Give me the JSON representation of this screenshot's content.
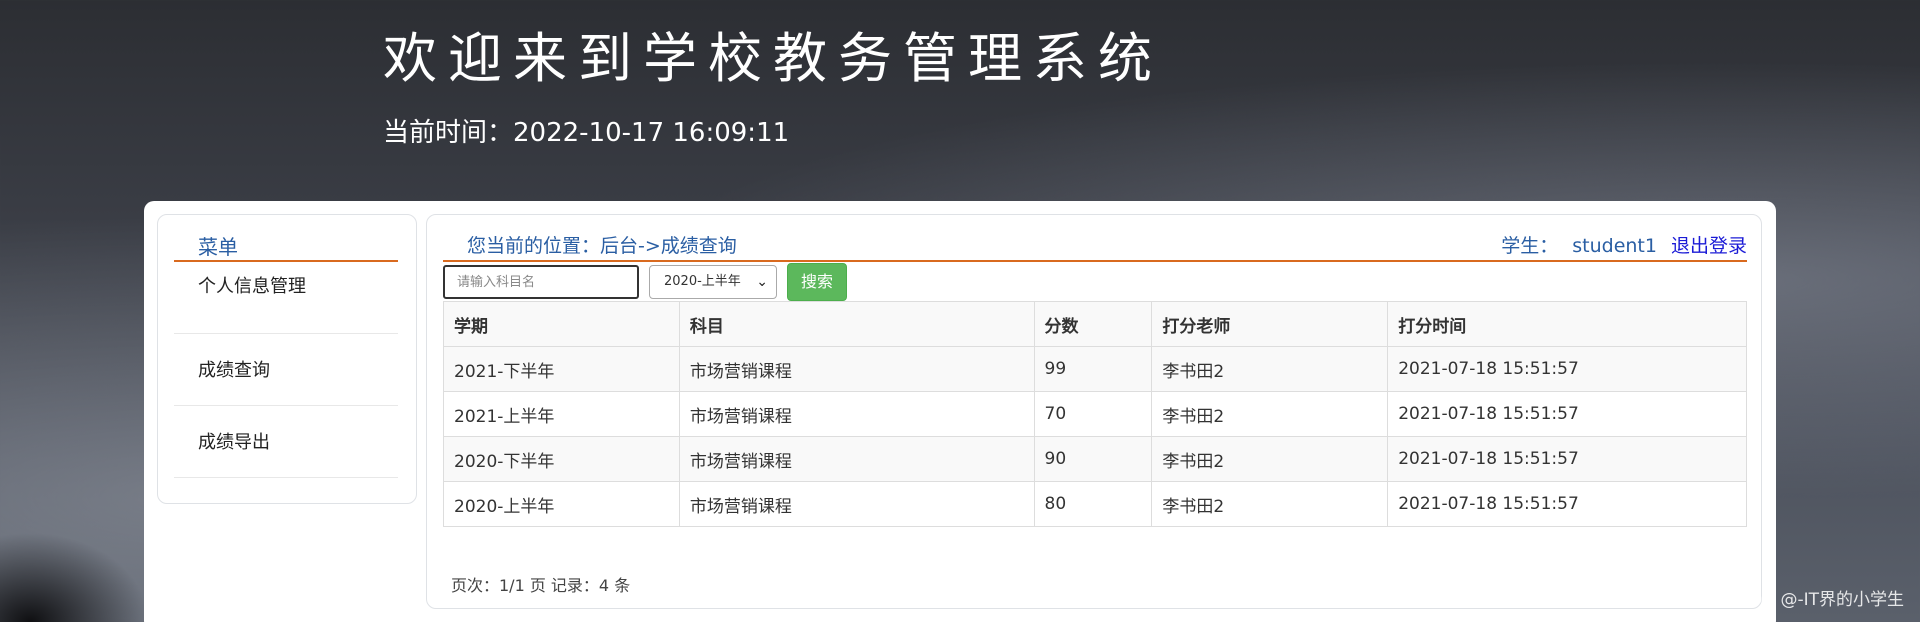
{
  "header": {
    "title": "欢迎来到学校教务管理系统",
    "time_label": "当前时间：",
    "time_value": "2022-10-17 16:09:11"
  },
  "sidebar": {
    "title": "菜单",
    "items": [
      {
        "label": "个人信息管理"
      },
      {
        "label": "成绩查询"
      },
      {
        "label": "成绩导出"
      }
    ]
  },
  "main": {
    "location_label": "您当前的位置：",
    "location_path": "后台->成绩查询",
    "user_label": "学生：",
    "user_name": "student1",
    "logout_label": "退出登录",
    "search": {
      "placeholder": "请输入科目名",
      "term_selected": "2020-上半年",
      "button_label": "搜索"
    },
    "table": {
      "columns": [
        "学期",
        "科目",
        "分数",
        "打分老师",
        "打分时间"
      ],
      "rows": [
        [
          "2021-下半年",
          "市场营销课程",
          "99",
          "李书田2",
          "2021-07-18 15:51:57"
        ],
        [
          "2021-上半年",
          "市场营销课程",
          "70",
          "李书田2",
          "2021-07-18 15:51:57"
        ],
        [
          "2020-下半年",
          "市场营销课程",
          "90",
          "李书田2",
          "2021-07-18 15:51:57"
        ],
        [
          "2020-上半年",
          "市场营销课程",
          "80",
          "李书田2",
          "2021-07-18 15:51:57"
        ]
      ]
    },
    "pager": "页次：1/1 页 记录：4 条"
  },
  "watermark": "CSDN @-IT界的小学生",
  "colors": {
    "accent_line": "#d96a1f",
    "link_blue": "#2a5ea3",
    "search_button": "#5cb85c"
  },
  "icons": {
    "select_arrow": "chevron-down-icon"
  }
}
